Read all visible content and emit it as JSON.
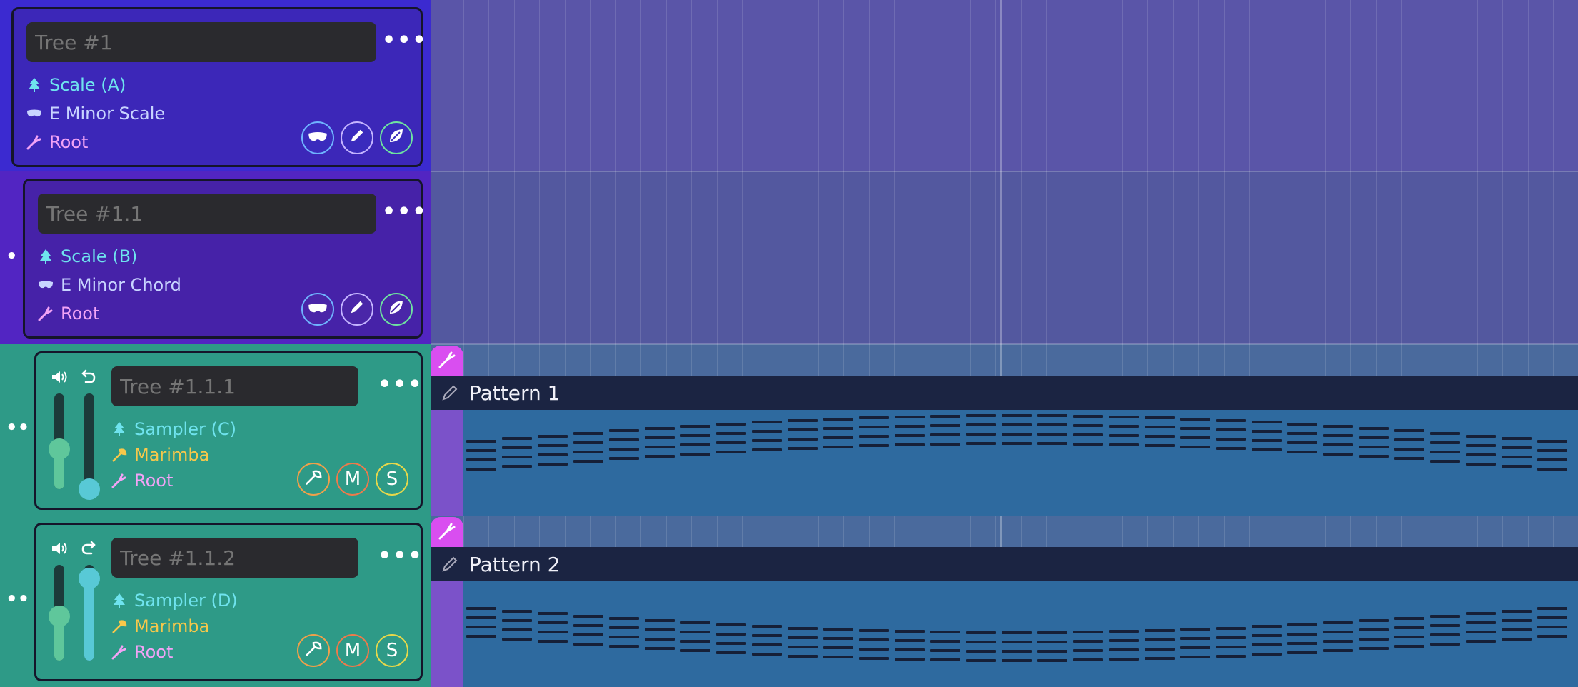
{
  "trees": [
    {
      "name_placeholder": "Tree #1",
      "scale": "Scale (A)",
      "mask": "E Minor Scale",
      "root": "Root",
      "actions": [
        "mask-icon",
        "pencil-icon",
        "leaf-icon"
      ]
    },
    {
      "name_placeholder": "Tree #1.1",
      "scale": "Scale (B)",
      "mask": "E Minor Chord",
      "root": "Root",
      "actions": [
        "mask-icon",
        "pencil-icon",
        "leaf-icon"
      ]
    },
    {
      "name_placeholder": "Tree #1.1.1",
      "sampler": "Sampler (C)",
      "instrument": "Marimba",
      "root": "Root",
      "mute": "M",
      "solo": "S",
      "volume": 0.42,
      "tune": 0.0
    },
    {
      "name_placeholder": "Tree #1.1.2",
      "sampler": "Sampler (D)",
      "instrument": "Marimba",
      "root": "Root",
      "mute": "M",
      "solo": "S",
      "volume": 0.46,
      "tune": 0.86
    }
  ],
  "menu_label": "•••",
  "patterns": [
    {
      "title": "Pattern 1"
    },
    {
      "title": "Pattern 2"
    }
  ],
  "colors": {
    "accent_cyan": "#6fe3ee",
    "accent_pink": "#f2a3f6",
    "accent_gold": "#f7c84a",
    "teal_row": "#2e9a87",
    "purple_row": "#3c27b8",
    "pattern_body": "#2e6a9f",
    "pattern_header": "#1b2442"
  }
}
